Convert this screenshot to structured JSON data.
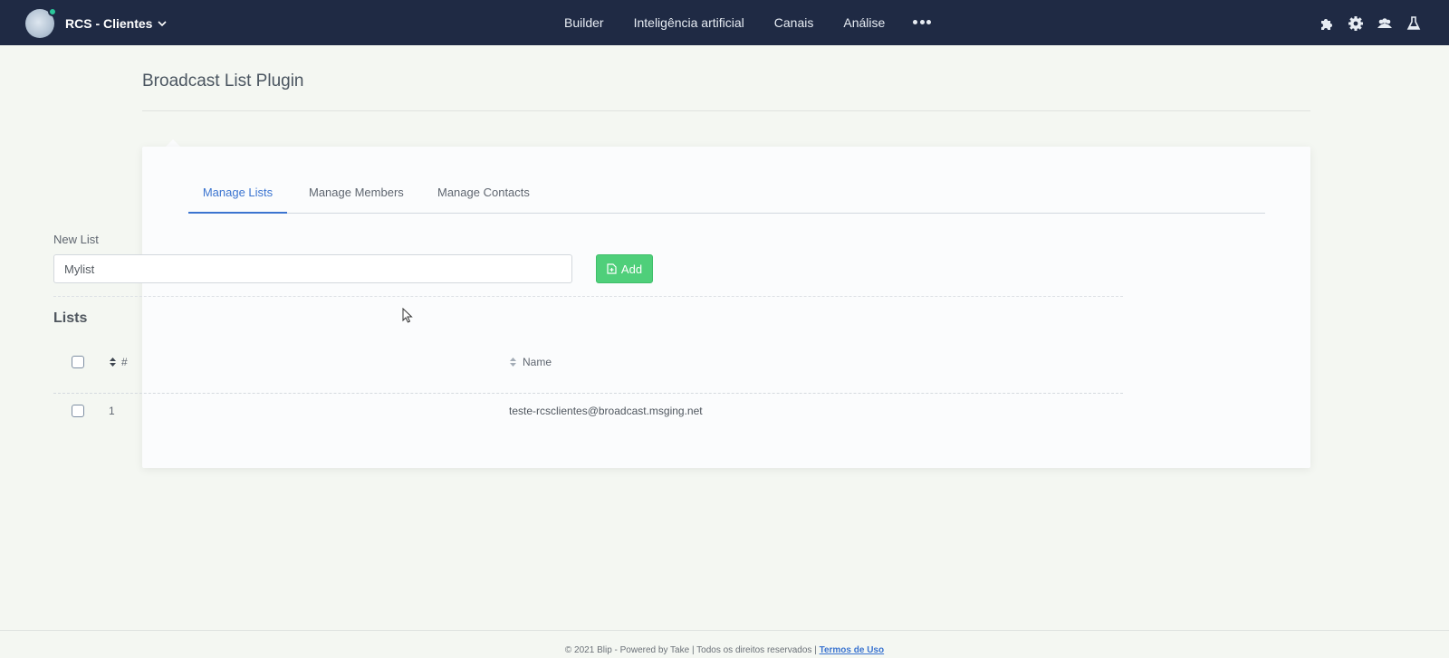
{
  "header": {
    "brand": "RCS - Clientes",
    "nav": [
      "Builder",
      "Inteligência artificial",
      "Canais",
      "Análise"
    ],
    "more_icon": "more-dots-icon",
    "right_icons": [
      "puzzle-icon",
      "gear-icon",
      "users-icon",
      "flask-icon"
    ]
  },
  "page": {
    "title": "Broadcast List Plugin"
  },
  "tabs": [
    "Manage Lists",
    "Manage Members",
    "Manage Contacts"
  ],
  "form": {
    "label": "New List",
    "value": "Mylist",
    "add_label": "Add"
  },
  "lists": {
    "heading": "Lists",
    "columns": [
      "#",
      "Name"
    ],
    "rows": [
      {
        "id": "1",
        "name": "teste-rcsclientes@broadcast.msging.net"
      }
    ]
  },
  "footer": {
    "text": "© 2021 Blip - Powered by Take | Todos os direitos reservados |",
    "link": "Termos de Uso"
  },
  "colors": {
    "topbar": "#1f2a44",
    "accent": "#3b74d0",
    "add_button": "#4fcf7a",
    "status_dot": "#2bc79a"
  }
}
